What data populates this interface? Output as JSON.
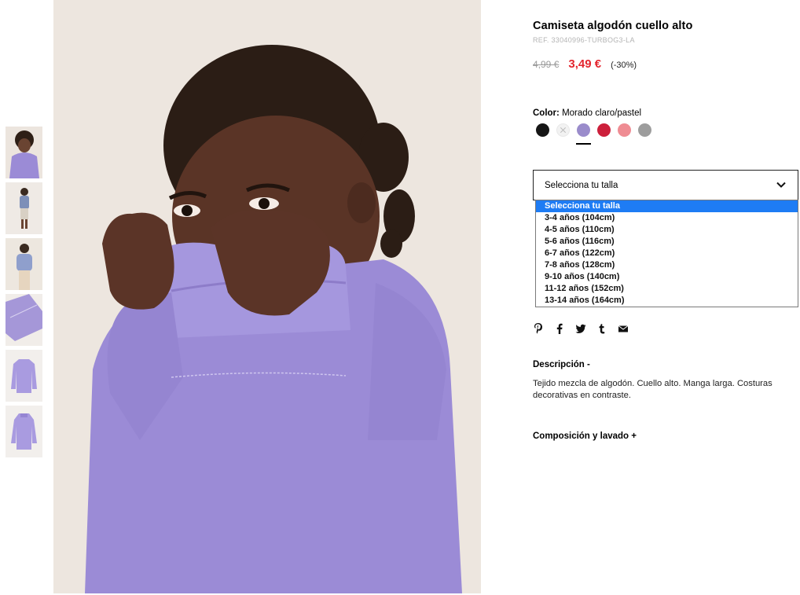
{
  "product": {
    "title": "Camiseta algodón cuello alto",
    "ref": "REF. 33040996-TURBOG3-LA",
    "old_price": "4,99 €",
    "new_price": "3,49 €",
    "discount": "(-30%)"
  },
  "color": {
    "label": "Color:",
    "value": "Morado claro/pastel",
    "swatches": [
      {
        "name": "black",
        "hex": "#161616"
      },
      {
        "name": "unavailable",
        "hex": "#f2f2f2"
      },
      {
        "name": "lilac",
        "hex": "#9a8ccb",
        "selected": true
      },
      {
        "name": "red",
        "hex": "#cc1f3b"
      },
      {
        "name": "pink",
        "hex": "#ef8c93"
      },
      {
        "name": "grey",
        "hex": "#9d9d9d"
      }
    ]
  },
  "size": {
    "select_label": "Selecciona tu talla",
    "options": [
      "Selecciona tu talla",
      "3-4 años (104cm)",
      "4-5 años (110cm)",
      "5-6 años (116cm)",
      "6-7 años (122cm)",
      "7-8 años (128cm)",
      "9-10 años (140cm)",
      "11-12 años (152cm)",
      "13-14 años (164cm)"
    ]
  },
  "share": [
    "pinterest-icon",
    "facebook-icon",
    "twitter-icon",
    "tumblr-icon",
    "email-icon"
  ],
  "description": {
    "title": "Descripción -",
    "text": "Tejido mezcla de algodón. Cuello alto. Manga larga. Costuras decorativas en contraste."
  },
  "composition": {
    "title": "Composición y lavado +"
  },
  "colors": {
    "accent": "#e3262f",
    "highlight": "#1e7cf4",
    "garment": "#9b8bd6"
  }
}
